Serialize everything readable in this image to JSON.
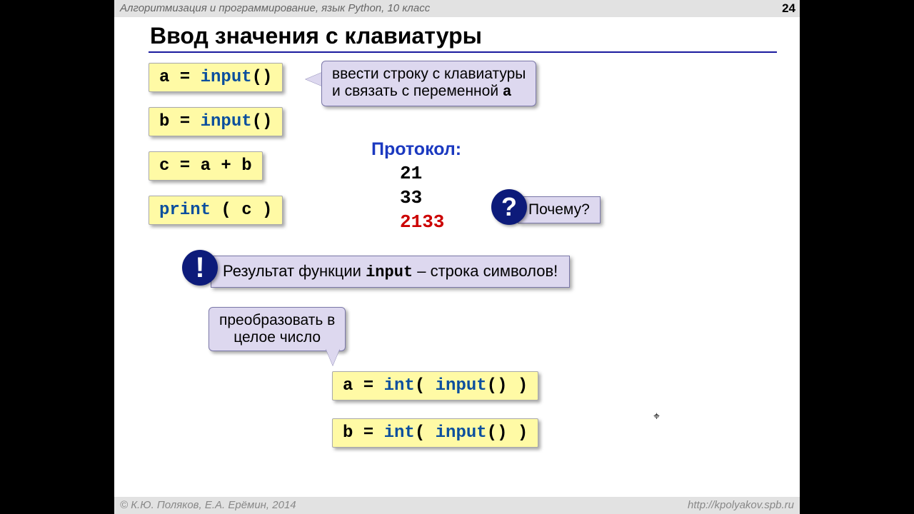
{
  "header": {
    "course_title": "Алгоритмизация и программирование, язык Python, 10 класс",
    "slide_number": "24"
  },
  "title": "Ввод значения с клавиатуры",
  "code": {
    "line1_var": "a",
    "line1_fn": "input",
    "line2_var": "b",
    "line2_fn": "input",
    "line3": "c = a + b",
    "line4_fn": "print",
    "line4_arg": "( c )",
    "int_a_var": "a",
    "int_b_var": "b",
    "int_fn": "int",
    "input_fn": "input"
  },
  "callouts": {
    "input_desc_1": "ввести строку с клавиатуры",
    "input_desc_2": "и связать с переменной",
    "input_desc_var": "a",
    "convert_1": "преобразовать в",
    "convert_2": "целое число"
  },
  "protocol": {
    "label": "Протокол:",
    "v1": "21",
    "v2": "33",
    "result": "2133"
  },
  "why": {
    "badge": "?",
    "label": "Почему?"
  },
  "note": {
    "badge": "!",
    "t1": "Результат функции ",
    "fn": "input",
    "t2": " – строка символов!"
  },
  "footer": {
    "credit": "© К.Ю. Поляков, Е.А. Ерёмин, 2014",
    "url": "http://kpolyakov.spb.ru"
  }
}
